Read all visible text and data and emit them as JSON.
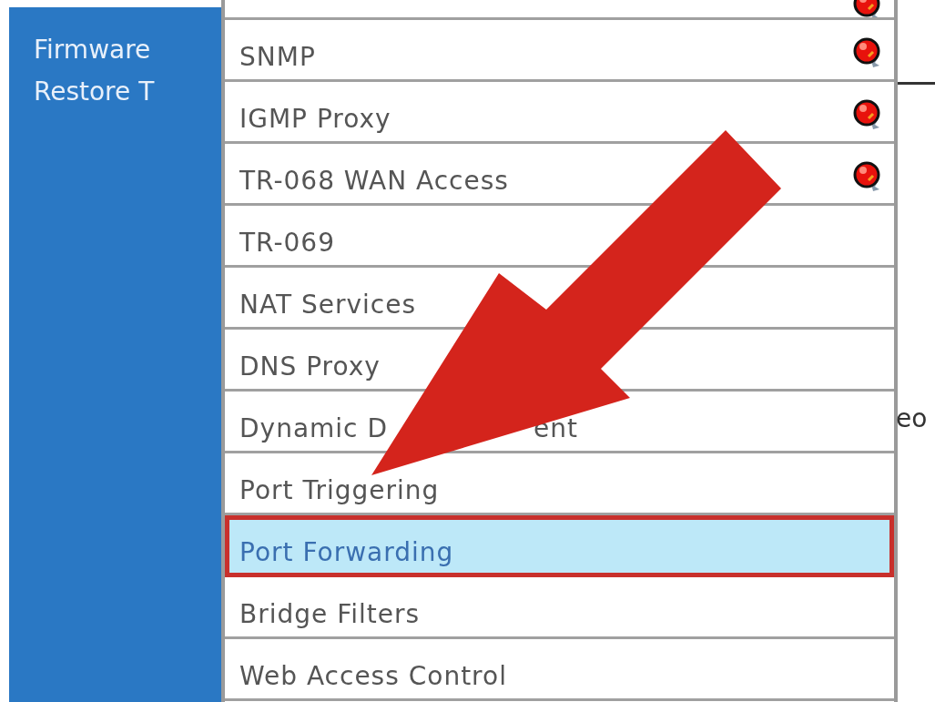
{
  "sidebar": {
    "items": [
      {
        "label": "Firmware"
      },
      {
        "label": "Restore T"
      }
    ]
  },
  "menu": {
    "items": [
      {
        "alert": true,
        "selected": false
      },
      {
        "label": "SNMP",
        "alert": true,
        "selected": false
      },
      {
        "label": "IGMP Proxy",
        "alert": true,
        "selected": false
      },
      {
        "label": "TR-068 WAN Access",
        "alert": true,
        "selected": false
      },
      {
        "label": "TR-069",
        "alert": false,
        "selected": false
      },
      {
        "label": "NAT Services",
        "alert": false,
        "selected": false
      },
      {
        "label": "DNS Proxy",
        "alert": false,
        "selected": false
      },
      {
        "label": "Dynamic D",
        "label_tail": "ent",
        "alert": false,
        "selected": false
      },
      {
        "label": "Port Triggering",
        "alert": false,
        "selected": false
      },
      {
        "label": "Port Forwarding",
        "alert": false,
        "selected": true
      },
      {
        "label": "Bridge Filters",
        "alert": false,
        "selected": false
      },
      {
        "label": "Web Access Control",
        "alert": false,
        "selected": false
      }
    ]
  },
  "side_text": "eo"
}
